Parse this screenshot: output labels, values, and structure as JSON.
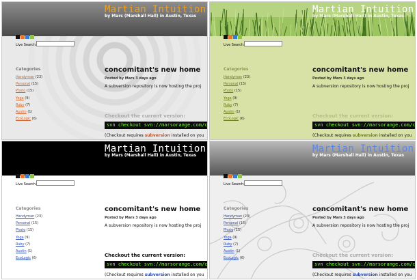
{
  "site": {
    "title": "Martian Intuition",
    "byline": "by Mars (Marshall Hall) in Austin, Texas"
  },
  "search": {
    "label": "Live Search:",
    "value": ""
  },
  "categories": {
    "heading": "Categories",
    "items": [
      {
        "name": "Handyman",
        "count": "(23)"
      },
      {
        "name": "Personal",
        "count": "(15)"
      },
      {
        "name": "Photo",
        "count": "(15)"
      },
      {
        "name": "Yoga",
        "count": "(9)"
      },
      {
        "name": "Ruby",
        "count": "(7)"
      },
      {
        "name": "Austin",
        "count": "(1)"
      },
      {
        "name": "EcoLogic",
        "count": "(6)"
      }
    ]
  },
  "post": {
    "title": "concomitant's new home",
    "meta": "Posted by Mars 3 days ago",
    "body": "A subversion repository is now hosting the proj",
    "section_heading": "Checkout the current version:",
    "code": "svn checkout svn://marsorange.com/con",
    "note_prefix": "(Checkout requires ",
    "note_link": "subversion",
    "note_suffix": " installed on you"
  },
  "swatch_colors": [
    "#111111",
    "#e8742a",
    "#3a78d6",
    "#8cc63e"
  ],
  "themes": [
    {
      "name": "orange-circles",
      "title_color": "#f0a020",
      "accent": "#d2642c"
    },
    {
      "name": "green-grass",
      "title_color": "#ffffff",
      "accent": "#6b7e1e"
    },
    {
      "name": "black-plain",
      "title_color": "#ffffff",
      "accent": "#2b4bb8"
    },
    {
      "name": "gray-swirls",
      "title_color": "#5b86e8",
      "accent": "#2b4bb8"
    }
  ]
}
